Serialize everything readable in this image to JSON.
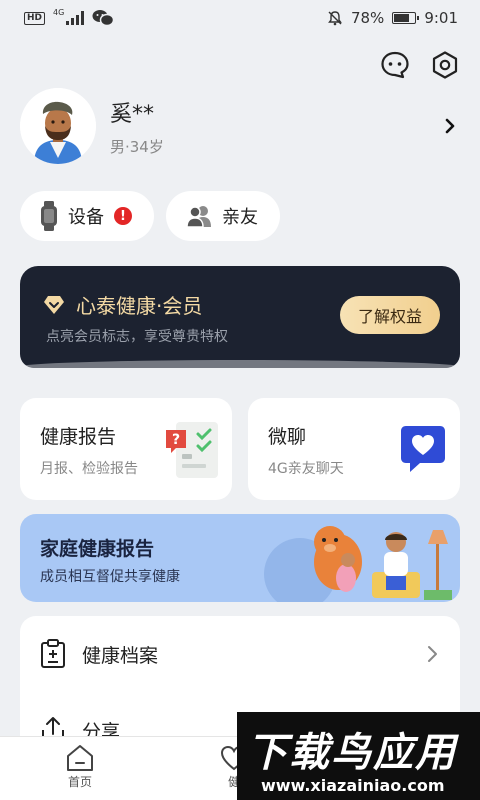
{
  "status_bar": {
    "hd": "HD",
    "network": "4G",
    "battery_percent": "78%",
    "battery_level": 0.78,
    "time": "9:01"
  },
  "top_icons": [
    "chat-bubble-icon",
    "settings-hexagon-icon"
  ],
  "profile": {
    "name": "奚**",
    "info": "男·34岁"
  },
  "chips": {
    "device_label": "设备",
    "device_badge": "!",
    "family_label": "亲友"
  },
  "member": {
    "title": "心泰健康·会员",
    "subtitle": "点亮会员标志，享受尊贵特权",
    "button": "了解权益"
  },
  "health_report": {
    "title": "健康报告",
    "subtitle": "月报、检验报告"
  },
  "wechat": {
    "title": "微聊",
    "subtitle": "4G亲友聊天"
  },
  "family_report": {
    "title": "家庭健康报告",
    "subtitle": "成员相互督促共享健康"
  },
  "list": {
    "records": "健康档案",
    "share": "分享"
  },
  "tabbar": {
    "home": "首页",
    "second_partial": "健"
  },
  "watermark": {
    "title": "下载鸟应用",
    "url": "www.xiazainiao.com"
  },
  "colors": {
    "member_bg": "#1c2230",
    "member_gold": "#f3d9a4",
    "family_bg": "#a9c8f5",
    "badge_red": "#e32626",
    "page_bg": "#eef0f3"
  }
}
